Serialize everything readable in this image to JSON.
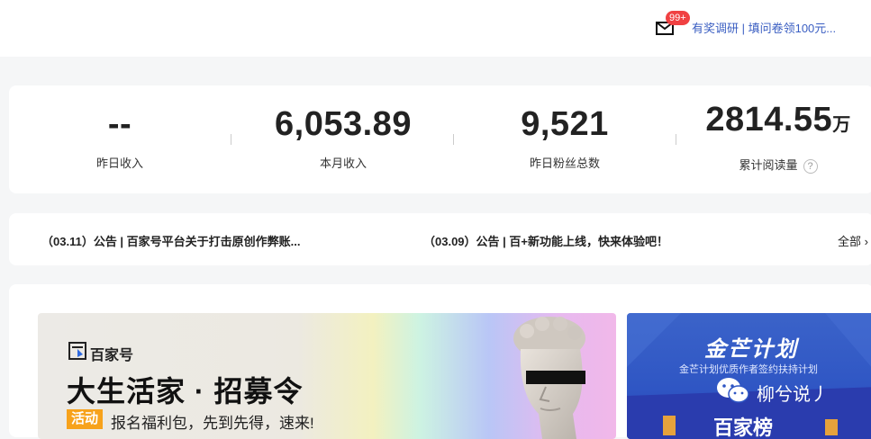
{
  "header": {
    "mail_badge": "99+",
    "survey_link": "有奖调研 | 填问卷领100元..."
  },
  "stats": [
    {
      "value": "--",
      "unit": "",
      "label": "昨日收入"
    },
    {
      "value": "6,053.89",
      "unit": "",
      "label": "本月收入"
    },
    {
      "value": "9,521",
      "unit": "",
      "label": "昨日粉丝总数"
    },
    {
      "value": "2814.55",
      "unit": "万",
      "label": "累计阅读量",
      "help": "?"
    }
  ],
  "notices": {
    "items": [
      "（03.11）公告 | 百家号平台关于打击原创作弊账...",
      "（03.09）公告 | 百+新功能上线，快来体验吧！"
    ],
    "all_label": "全部 ›"
  },
  "banners": {
    "main": {
      "logo_text": "百家号",
      "title": "大生活家 · 招募令",
      "tag": "活动",
      "subtitle": "报名福利包，先到先得，速来!"
    },
    "side": {
      "title": "金芒计划",
      "subtitle": "金芒计划优质作者签约扶持计划",
      "bottom_text": "百家榜"
    }
  },
  "watermark": {
    "text": "柳兮说丿"
  },
  "colors": {
    "link": "#3a5ec2",
    "badge": "#f04142",
    "tag": "#f7a21b",
    "side_banner": "#2f56c4"
  }
}
